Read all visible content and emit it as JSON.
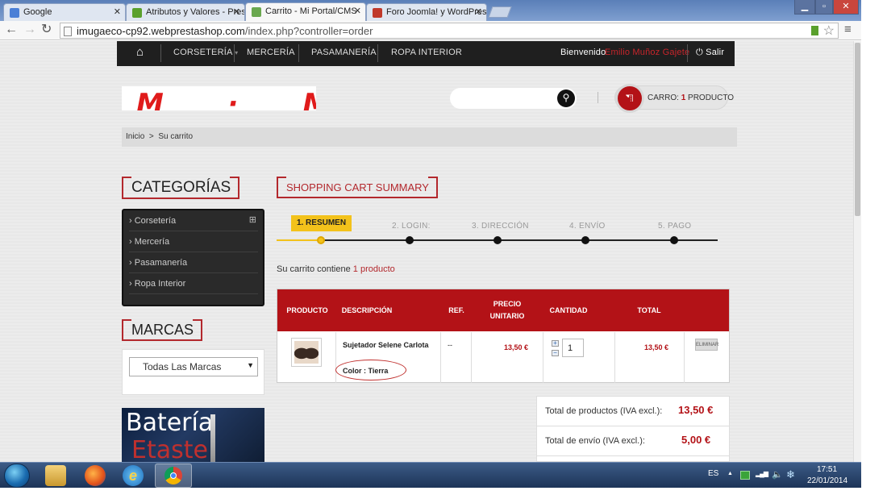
{
  "browser": {
    "tabs": [
      {
        "title": "Google",
        "favicon_color": "#4a7fd6"
      },
      {
        "title": "Atributos y Valores - Prest",
        "favicon_color": "#5aa02c"
      },
      {
        "title": "Carrito - Mi Portal/CMS",
        "favicon_color": "#6aa84f"
      },
      {
        "title": "Foro Joomla! y WordPress",
        "favicon_color": "#c0392b"
      }
    ],
    "tab_close": "✕",
    "window_controls": {
      "minimize": "▁",
      "maximize": "▫",
      "close": "✕"
    },
    "url_host": "imugaeco-cp92.webprestashop.com",
    "url_path": "/index.php?controller=order",
    "nav": {
      "back": "←",
      "forward": "→",
      "reload": "↻",
      "star": "☆",
      "menu": "≡"
    }
  },
  "topnav": {
    "home_icon": "⌂",
    "items": [
      "CORSETERÍA",
      "MERCERÍA",
      "PASAMANERÍA",
      "ROPA INTERIOR"
    ],
    "dropdown_caret": "▾",
    "welcome": "Bienvenido",
    "user_name": "Emilio Muñoz Gajete",
    "logout_icon": "⏻",
    "logout": "Salir"
  },
  "header": {
    "logo_text": "M · M",
    "search_placeholder": "",
    "search_icon": "🔍",
    "cart_icon": "🛒",
    "cart_label": "CARRO:",
    "cart_count": "1",
    "cart_unit": "PRODUCTO"
  },
  "breadcrumb": {
    "home": "Inicio",
    "sep": ">",
    "current": "Su carrito"
  },
  "sidebar": {
    "categories_title": "CATEGORÍAS",
    "categories": [
      "Corsetería",
      "Mercería",
      "Pasamanería",
      "Ropa Interior"
    ],
    "expand_icon": "⊞",
    "bullet": "›",
    "brands_title": "MARCAS",
    "brands_select": "Todas Las Marcas",
    "select_arrow": "▼",
    "banner_line1": "Batería",
    "banner_line2": "Etaste"
  },
  "main": {
    "title": "SHOPPING CART SUMMARY",
    "steps": [
      "1. RESUMEN",
      "2. LOGIN:",
      "3. DIRECCIÓN",
      "4. ENVÍO",
      "5. PAGO"
    ],
    "active_step_color": "#f3c21b",
    "cart_contains_prefix": "Su carrito contiene",
    "cart_contains_count": "1 producto",
    "table": {
      "headers": [
        "PRODUCTO",
        "DESCRIPCIÓN",
        "REF.",
        "PRECIO UNITARIO",
        "CANTIDAD",
        "TOTAL"
      ],
      "rows": [
        {
          "name": "Sujetador Selene Carlota",
          "attribute": "Color : Tierra",
          "ref": "--",
          "unit_price": "13,50 €",
          "quantity": "1",
          "qty_up": "+",
          "qty_down": "−",
          "total": "13,50 €",
          "delete": "ELIMINAR"
        }
      ]
    },
    "summary": [
      {
        "label": "Total de productos (IVA excl.):",
        "value": "13,50 €"
      },
      {
        "label": "Total de envío (IVA excl.):",
        "value": "5,00 €"
      }
    ]
  },
  "taskbar": {
    "language": "ES",
    "time": "17:51",
    "date": "22/01/2014",
    "tray_arrow": "▲",
    "signal_icon": "▂▄▆",
    "volume_icon": "🔈"
  },
  "colors": {
    "brand_red": "#b31217",
    "nav_dark": "#1f1f1f",
    "accent_yellow": "#f3c21b"
  }
}
